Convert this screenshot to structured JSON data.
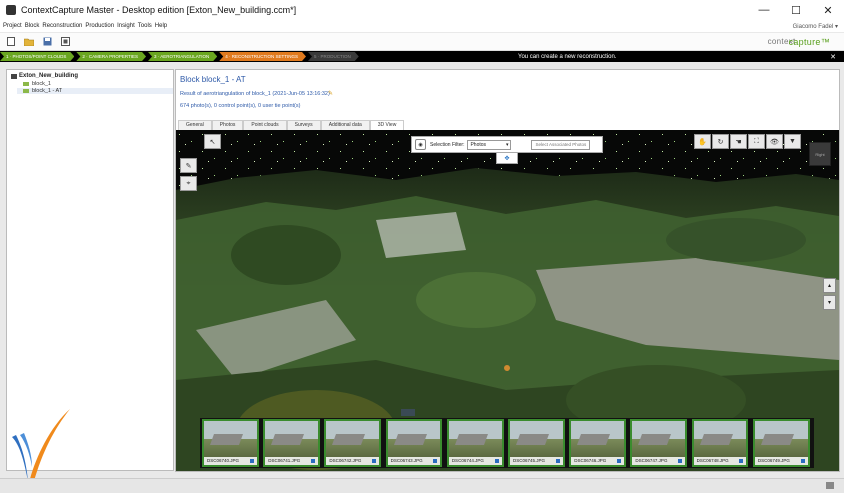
{
  "window": {
    "title": "ContextCapture Master - Desktop edition [Exton_New_building.ccm*]",
    "minimize": "—",
    "maximize": "☐",
    "close": "✕"
  },
  "menu": {
    "items": [
      "Project",
      "Block",
      "Reconstruction",
      "Production",
      "Insight",
      "Tools",
      "Help"
    ],
    "user": "Giacomo Fadel ▾"
  },
  "toolbar": {
    "brand_prefix": "context",
    "brand_suffix": "capture™",
    "icons": [
      "new-project-icon",
      "open-project-icon",
      "save-project-icon",
      "settings-icon"
    ]
  },
  "steps": {
    "items": [
      {
        "label": "1 · PHOTOS/POINT CLOUDS",
        "state": "green"
      },
      {
        "label": "2 · CAMERA PROPERTIES",
        "state": "green"
      },
      {
        "label": "3 · AEROTRIANGULATION",
        "state": "green"
      },
      {
        "label": "4 · RECONSTRUCTION SETTINGS",
        "state": "orange"
      },
      {
        "label": "5 · PRODUCTION",
        "state": "grey"
      }
    ],
    "message": "You can create a new reconstruction.",
    "close": "✕"
  },
  "tree": {
    "root": "Exton_New_building",
    "items": [
      {
        "label": "block_1"
      },
      {
        "label": "block_1 - AT"
      }
    ]
  },
  "block": {
    "heading": "Block   block_1 - AT",
    "subtitle": "Result of aerotriangulation of block_1 (2021-Jun-05 13:16:32)",
    "info": "674 photo(s), 0 control point(s), 0 user tie point(s)"
  },
  "tabs": [
    "General",
    "Photos",
    "Point clouds",
    "Surveys",
    "Additional data",
    "3D View"
  ],
  "viewer": {
    "filter_label": "Selection Filter:",
    "filter_value": "Photos",
    "filter_button": "Select Associated Photos",
    "nav_cube": "Right"
  },
  "thumbnails": [
    "DSC06740.JPG",
    "DSC06741.JPG",
    "DSC06742.JPG",
    "DSC06743.JPG",
    "DSC06744.JPG",
    "DSC06745.JPG",
    "DSC06746.JPG",
    "DSC06747.JPG",
    "DSC06748.JPG",
    "DSC06749.JPG"
  ],
  "colors": {
    "step_green": "#6aa620",
    "step_orange": "#e07a1e",
    "link_blue": "#2e5aa8",
    "brand_green": "#5aa01e"
  }
}
